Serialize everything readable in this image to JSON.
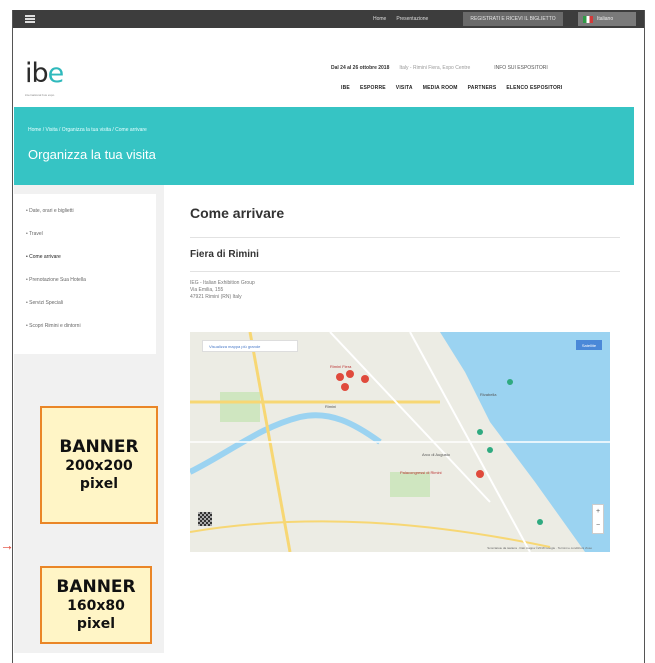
{
  "topbar": {
    "links": [
      "Home",
      "Presentazione"
    ],
    "register_label": "REGISTRATI E RICEVI IL BIGLIETTO",
    "language": "Italiano"
  },
  "header": {
    "logo_text": "ibe",
    "logo_sub": "international bus expo",
    "dates": "Dal 24 al 26 ottobre 2018",
    "venue_line": "Italy - Rimini Fiera, Expo Centre",
    "cta": "INFO SUI ESPOSITORI",
    "nav": [
      "IBE",
      "ESPORRE",
      "VISITA",
      "MEDIA ROOM",
      "PARTNERS",
      "ELENCO ESPOSITORI"
    ]
  },
  "hero": {
    "breadcrumb": "Home / Visita / Organizza la tua visita / Come arrivare",
    "title": "Organizza la tua visita"
  },
  "sidebar": {
    "items": [
      {
        "label": "Date, orari e biglietti"
      },
      {
        "label": "Travel"
      },
      {
        "label": "Come arrivare"
      },
      {
        "label": "Prenotazione Sua Hotella"
      },
      {
        "label": "Servizi Speciali"
      },
      {
        "label": "Scopri Rimini e dintorni"
      }
    ]
  },
  "content": {
    "title": "Come arrivare",
    "venue_name": "Fiera di Rimini",
    "address_lines": [
      "IEG - Italian Exhibition Group",
      "Via Emilia, 155",
      "47921 Rimini (RN) Italy"
    ]
  },
  "map": {
    "open_label": "Visualizza mappa più grande",
    "mode_label": "Satellite",
    "zoom_in": "+",
    "zoom_out": "−",
    "footer": "Scorciatoie da tastiera · Dati mappa ©2018 Google · Termini e condizioni d'uso",
    "labels": {
      "fair": "Rimini Fiera",
      "station": "Palacongressi di Rimini",
      "area1": "Rimini",
      "area2": "Arco di Augusto",
      "area3": "Rivabella"
    },
    "colors": {
      "sea": "#9bd3f1",
      "road": "#f7d774",
      "park": "#cfe6c0",
      "marker": "#e04a3c"
    }
  },
  "banners": {
    "large": {
      "line1": "BANNER",
      "line2": "200x200",
      "line3": "pixel"
    },
    "small": {
      "line1": "BANNER",
      "line2": "160x80",
      "line3": "pixel"
    }
  },
  "colors": {
    "teal": "#36c4c4",
    "banner_bg": "#fff5c6",
    "banner_border": "#ea8627"
  }
}
